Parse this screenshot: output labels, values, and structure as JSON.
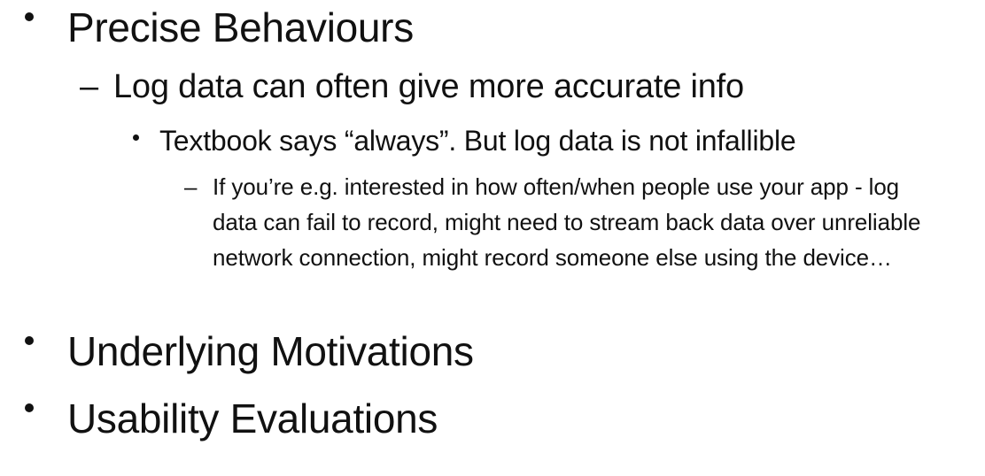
{
  "slide": {
    "items": [
      {
        "level": 1,
        "text": "Precise Behaviours"
      },
      {
        "level": 2,
        "marker": "–",
        "text": "Log data can often give more accurate info"
      },
      {
        "level": 3,
        "text": "Textbook says “always”. But log data is not infallible"
      },
      {
        "level": 4,
        "marker": "–",
        "text": "If you’re e.g. interested in how often/when people use your app - log data can fail to record, might need to stream back data over unreliable network connection, might record someone else using the device…"
      },
      {
        "level": 1,
        "text": "Underlying Motivations"
      },
      {
        "level": 1,
        "text": "Usability Evaluations"
      }
    ]
  }
}
